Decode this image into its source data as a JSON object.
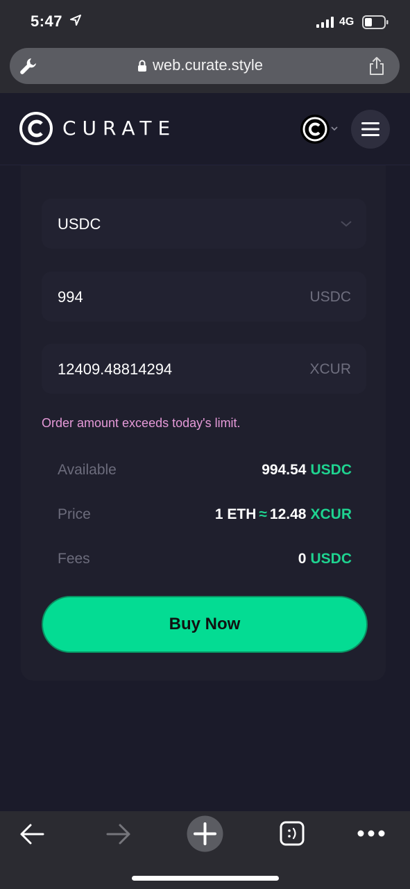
{
  "status_bar": {
    "time": "5:47",
    "network": "4G"
  },
  "browser": {
    "url": "web.curate.style"
  },
  "app": {
    "brand": "CURATE"
  },
  "form": {
    "currency_select": "USDC",
    "amount_value": "994",
    "amount_unit": "USDC",
    "receive_value": "12409.48814294",
    "receive_unit": "XCUR",
    "error": "Order amount exceeds today's limit."
  },
  "summary": {
    "available_label": "Available",
    "available_value": "994.54",
    "available_unit": "USDC",
    "price_label": "Price",
    "price_left": "1 ETH",
    "price_approx": "≈",
    "price_value": "12.48",
    "price_unit": "XCUR",
    "fees_label": "Fees",
    "fees_value": "0",
    "fees_unit": "USDC"
  },
  "actions": {
    "buy_label": "Buy Now"
  },
  "colors": {
    "accent": "#04dc93",
    "currency": "#1fd390",
    "error": "#e69ad9",
    "background": "#1b1b2a"
  }
}
